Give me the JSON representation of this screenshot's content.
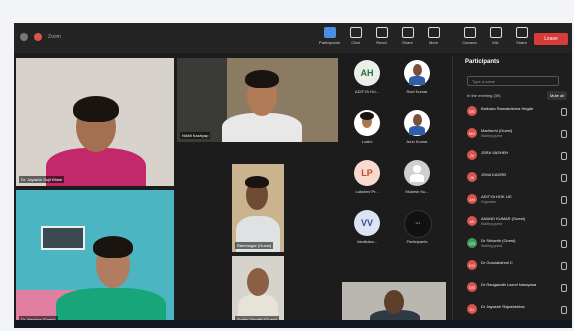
{
  "window": {
    "title": "Zoom"
  },
  "toolbar": {
    "items": [
      {
        "label": "Participants",
        "icon": "people-icon"
      },
      {
        "label": "Chat",
        "icon": "chat-icon"
      },
      {
        "label": "React",
        "icon": "react-icon"
      },
      {
        "label": "Share",
        "icon": "share-icon"
      },
      {
        "label": "More",
        "icon": "more-icon"
      }
    ],
    "right": [
      {
        "label": "Camera",
        "icon": "camera-icon"
      },
      {
        "label": "Mic",
        "icon": "mic-icon"
      },
      {
        "label": "Share",
        "icon": "share-screen-icon"
      }
    ],
    "leave_label": "Leave"
  },
  "tiles": {
    "t1": "Dr. Jayashri Sujit Bhise",
    "t2": "Nikhil Kashyap",
    "t3": "Dr. Manjula (Guest)",
    "t4": "Rammagar (Guest)",
    "t5": "Sudhir Tripathi (Guest)",
    "t6": ""
  },
  "avatars": [
    {
      "initials": "AH",
      "label": "ADITYA HU...",
      "bg": "#e8f0e8",
      "fg": "#2e6b3c"
    },
    {
      "initials": "",
      "label": "Ravi Kumar",
      "bg": "#ffffff",
      "fg": "#333"
    },
    {
      "initials": "",
      "label": "Lodini",
      "bg": "#ffffff",
      "fg": "#333"
    },
    {
      "initials": "",
      "label": "Arun Kumar",
      "bg": "#ffffff",
      "fg": "#333"
    },
    {
      "initials": "LP",
      "label": "Lakshmi Pr...",
      "bg": "#f7d9cf",
      "fg": "#c2492a"
    },
    {
      "initials": "",
      "label": "Mukesh Ku...",
      "bg": "#cfcfcf",
      "fg": "#555"
    },
    {
      "initials": "VV",
      "label": "Vardhaka...",
      "bg": "#dbe3f5",
      "fg": "#3b4f8c"
    },
    {
      "initials": "",
      "label": "Participants",
      "bg": "#111111",
      "fg": "#fff"
    }
  ],
  "participants_panel": {
    "title": "Participants",
    "search_placeholder": "Type a name",
    "section": "In the meeting (39)",
    "mute_all": "Mute all",
    "rows": [
      {
        "name": "Balkrato Ramakrishna Hegde",
        "sub": "",
        "av": "BR",
        "bg": "#d9534f"
      },
      {
        "name": "Madhurhi (Guest)",
        "sub": "Waiting guest",
        "av": "MG",
        "bg": "#d9534f"
      },
      {
        "name": "JSRA VASHEH",
        "sub": "",
        "av": "JV",
        "bg": "#d9534f"
      },
      {
        "name": "JSHA KADRB",
        "sub": "",
        "av": "JK",
        "bg": "#d9534f"
      },
      {
        "name": "ADITYA HOK LIE",
        "sub": "Organiser",
        "av": "AH",
        "bg": "#d9534f"
      },
      {
        "name": "ANAND KUMAR (Guest)",
        "sub": "Waiting guest",
        "av": "AK",
        "bg": "#d9534f"
      },
      {
        "name": "Dr Srikanth (Guest)",
        "sub": "Waiting guest",
        "av": "DS",
        "bg": "#3c9d5a"
      },
      {
        "name": "Dr Gurulakshmi C",
        "sub": "",
        "av": "DG",
        "bg": "#d9534f"
      },
      {
        "name": "Dr Ranganath Laxmi Narayana",
        "sub": "",
        "av": "DR",
        "bg": "#d9534f"
      },
      {
        "name": "Dr Jayashri Rajashekhar",
        "sub": "",
        "av": "DJ",
        "bg": "#d9534f"
      }
    ]
  }
}
